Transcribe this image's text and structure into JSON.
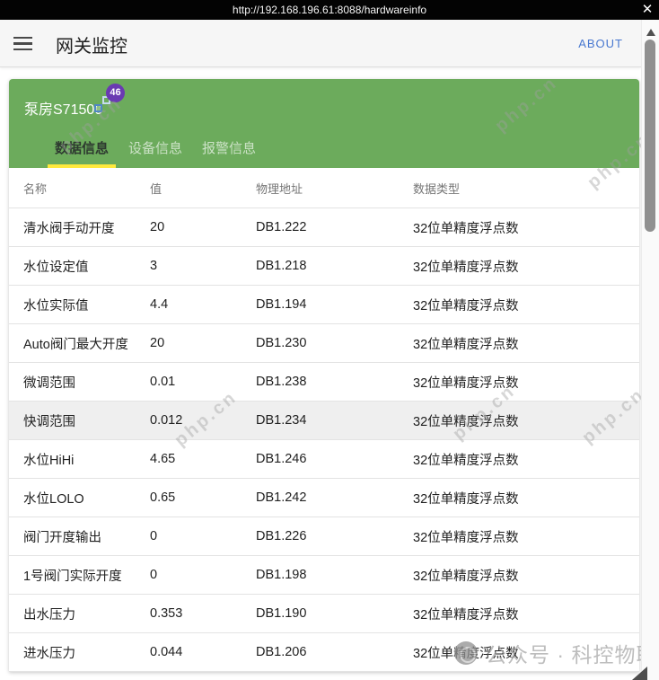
{
  "topbar": {
    "url": "http://192.168.196.61:8088/hardwareinfo",
    "close_icon": "✕"
  },
  "appbar": {
    "title": "网关监控",
    "about": "ABOUT"
  },
  "card": {
    "title": "泵房S71500",
    "badge_count": "46",
    "tabs": [
      {
        "label": "数据信息",
        "active": true
      },
      {
        "label": "设备信息",
        "active": false
      },
      {
        "label": "报警信息",
        "active": false
      }
    ]
  },
  "table": {
    "headers": [
      "名称",
      "值",
      "物理地址",
      "数据类型"
    ],
    "rows": [
      {
        "name": "清水阀手动开度",
        "value": "20",
        "address": "DB1.222",
        "type": "32位单精度浮点数",
        "highlighted": false
      },
      {
        "name": "水位设定值",
        "value": "3",
        "address": "DB1.218",
        "type": "32位单精度浮点数",
        "highlighted": false
      },
      {
        "name": "水位实际值",
        "value": "4.4",
        "address": "DB1.194",
        "type": "32位单精度浮点数",
        "highlighted": false
      },
      {
        "name": "Auto阀门最大开度",
        "value": "20",
        "address": "DB1.230",
        "type": "32位单精度浮点数",
        "highlighted": false
      },
      {
        "name": "微调范围",
        "value": "0.01",
        "address": "DB1.238",
        "type": "32位单精度浮点数",
        "highlighted": false
      },
      {
        "name": "快调范围",
        "value": "0.012",
        "address": "DB1.234",
        "type": "32位单精度浮点数",
        "highlighted": true
      },
      {
        "name": "水位HiHi",
        "value": "4.65",
        "address": "DB1.246",
        "type": "32位单精度浮点数",
        "highlighted": false
      },
      {
        "name": "水位LOLO",
        "value": "0.65",
        "address": "DB1.242",
        "type": "32位单精度浮点数",
        "highlighted": false
      },
      {
        "name": "阀门开度输出",
        "value": "0",
        "address": "DB1.226",
        "type": "32位单精度浮点数",
        "highlighted": false
      },
      {
        "name": "1号阀门实际开度",
        "value": "0",
        "address": "DB1.198",
        "type": "32位单精度浮点数",
        "highlighted": false
      },
      {
        "name": "出水压力",
        "value": "0.353",
        "address": "DB1.190",
        "type": "32位单精度浮点数",
        "highlighted": false
      },
      {
        "name": "进水压力",
        "value": "0.044",
        "address": "DB1.206",
        "type": "32位单精度浮点数",
        "highlighted": false
      }
    ]
  },
  "watermarks": {
    "site": "php.cn",
    "brand": "公众号 · 科控物联"
  },
  "colors": {
    "header_green": "#6cab5c",
    "badge_purple": "#6a3ab2",
    "tab_underline_yellow": "#ffe93d",
    "link_blue": "#4878d0",
    "row_highlight_gray": "#efefef"
  }
}
